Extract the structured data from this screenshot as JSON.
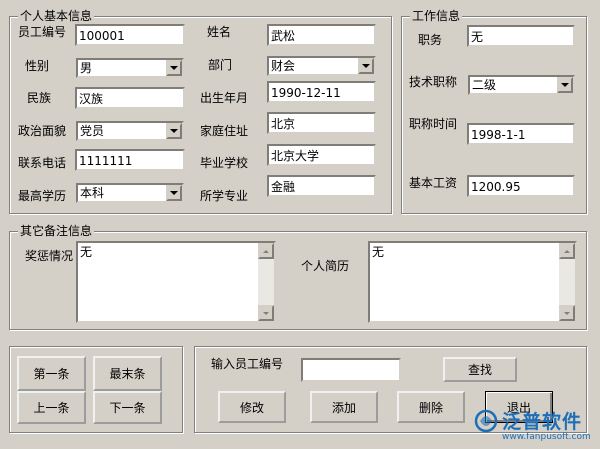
{
  "basic_info": {
    "title": "个人基本信息",
    "emp_no": {
      "label": "员工编号",
      "value": "100001"
    },
    "name": {
      "label": "姓名",
      "value": "武松"
    },
    "gender": {
      "label": "性别",
      "value": "男"
    },
    "dept": {
      "label": "部门",
      "value": "财会"
    },
    "ethnicity": {
      "label": "民族",
      "value": "汉族"
    },
    "birth": {
      "label": "出生年月",
      "value": "1990-12-11"
    },
    "political": {
      "label": "政治面貌",
      "value": "党员"
    },
    "home": {
      "label": "家庭住址",
      "value": "北京"
    },
    "phone": {
      "label": "联系电话",
      "value": "1111111"
    },
    "school": {
      "label": "毕业学校",
      "value": "北京大学"
    },
    "education": {
      "label": "最高学历",
      "value": "本科"
    },
    "major": {
      "label": "所学专业",
      "value": "金融"
    }
  },
  "work_info": {
    "title": "工作信息",
    "position": {
      "label": "职务",
      "value": "无"
    },
    "tech_title": {
      "label": "技术职称",
      "value": "二级"
    },
    "title_date": {
      "label": "职称时间",
      "value": "1998-1-1"
    },
    "salary": {
      "label": "基本工资",
      "value": "1200.95"
    }
  },
  "remarks": {
    "title": "其它备注信息",
    "awards": {
      "label": "奖惩情况",
      "value": "无"
    },
    "resume": {
      "label": "个人简历",
      "value": "无"
    }
  },
  "nav": {
    "first": "第一条",
    "last": "最末条",
    "prev": "上一条",
    "next": "下一条"
  },
  "actions": {
    "input_label": "输入员工编号",
    "input_value": "",
    "find": "查找",
    "edit": "修改",
    "add": "添加",
    "delete": "删除",
    "exit": "退出"
  },
  "watermark": {
    "brand": "泛普软件",
    "url": "www.fanpusoft.com",
    "color": "#1e6fb8"
  }
}
